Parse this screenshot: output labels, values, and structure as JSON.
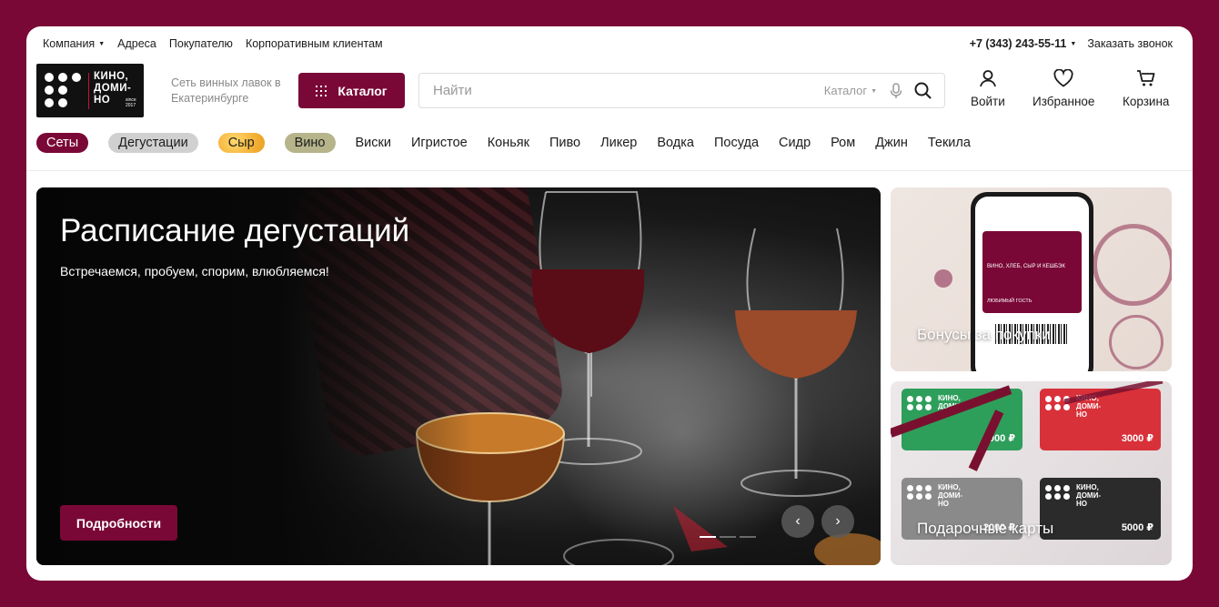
{
  "topbar": {
    "links": [
      "Компания",
      "Адреса",
      "Покупателю",
      "Корпоративным клиентам"
    ],
    "phone": "+7 (343) 243-55-11",
    "callback": "Заказать звонок"
  },
  "logo": {
    "line1": "КИНО,",
    "line2": "ДОМИ-",
    "line3": "НО",
    "since": "since 2017"
  },
  "tagline": "Сеть винных лавок в Екатеринбурге",
  "catalog_button": "Каталог",
  "search": {
    "placeholder": "Найти",
    "scope": "Каталог"
  },
  "header_actions": {
    "login": "Войти",
    "favorites": "Избранное",
    "cart": "Корзина"
  },
  "nav": {
    "pills": [
      "Сеты",
      "Дегустации",
      "Сыр",
      "Вино"
    ],
    "items": [
      "Виски",
      "Игристое",
      "Коньяк",
      "Пиво",
      "Ликер",
      "Водка",
      "Посуда",
      "Сидр",
      "Ром",
      "Джин",
      "Текила"
    ]
  },
  "hero": {
    "title": "Расписание дегустаций",
    "subtitle": "Встречаемся, пробуем, спорим, влюбляемся!",
    "button": "Подробности",
    "prev": "‹",
    "next": "›",
    "slides": 3,
    "active_slide": 1
  },
  "promo_cards": [
    {
      "caption": "Бонусы за покупки"
    },
    {
      "caption": "Подарочные карты"
    }
  ],
  "phone_screen": {
    "heading": "ВИНО, ХЛЕБ, СЫР И КЕШБЭК",
    "guest": "ЛЮБИМЫЙ ГОСТЬ"
  },
  "gift_cards": [
    {
      "amount": "1000 ₽",
      "color": "#2e9e5b"
    },
    {
      "amount": "3000 ₽",
      "color": "#d9313a"
    },
    {
      "amount": "2000 ₽",
      "color": "#8a8a8a"
    },
    {
      "amount": "5000 ₽",
      "color": "#2b2b2b"
    }
  ],
  "colors": {
    "brand": "#7a0836",
    "background": "#7a0836"
  }
}
